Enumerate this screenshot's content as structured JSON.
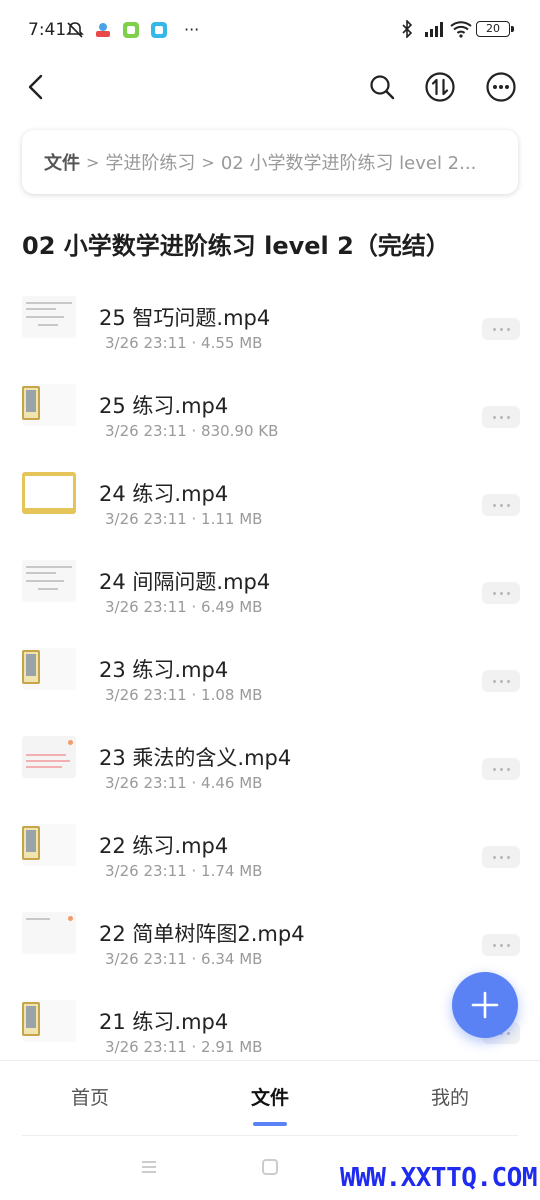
{
  "status_bar": {
    "time": "7:41",
    "more": "···",
    "battery": "20",
    "icons": [
      "mute-icon",
      "app-icon",
      "wechat-icon",
      "app2-icon",
      "bluetooth-icon",
      "signal-icon",
      "wifi-icon",
      "battery-icon"
    ]
  },
  "header": {
    "icons": [
      "back-icon",
      "search-icon",
      "transfer-icon",
      "more-icon"
    ]
  },
  "breadcrumb": {
    "items": [
      "文件",
      "学进阶练习",
      "02 小学数学进阶练习 level 2..."
    ],
    "separator": ">"
  },
  "page_title": "02 小学数学进阶练习 level 2（完结）",
  "files": [
    {
      "name": "25 智巧问题.mp4",
      "date": "3/26 23:11",
      "size": "4.55 MB",
      "thumb": "doc"
    },
    {
      "name": "25 练习.mp4",
      "date": "3/26 23:11",
      "size": "830.90 KB",
      "thumb": "tab"
    },
    {
      "name": "24 练习.mp4",
      "date": "3/26 23:11",
      "size": "1.11 MB",
      "thumb": "yellow"
    },
    {
      "name": "24 间隔问题.mp4",
      "date": "3/26 23:11",
      "size": "6.49 MB",
      "thumb": "doc"
    },
    {
      "name": "23 练习.mp4",
      "date": "3/26 23:11",
      "size": "1.08 MB",
      "thumb": "tab"
    },
    {
      "name": "23 乘法的含义.mp4",
      "date": "3/26 23:11",
      "size": "4.46 MB",
      "thumb": "pink"
    },
    {
      "name": "22 练习.mp4",
      "date": "3/26 23:11",
      "size": "1.74 MB",
      "thumb": "tab"
    },
    {
      "name": "22 简单树阵图2.mp4",
      "date": "3/26 23:11",
      "size": "6.34 MB",
      "thumb": "dot"
    },
    {
      "name": "21 练习.mp4",
      "date": "3/26 23:11",
      "size": "2.91 MB",
      "thumb": "tab"
    }
  ],
  "meta_separator": "·",
  "bottom_nav": {
    "items": [
      "首页",
      "文件",
      "我的"
    ],
    "active": "文件"
  },
  "watermark": "WWW.XXTTQ.COM",
  "colors": {
    "accent": "#5a82f4",
    "watermark": "#1f2cf0"
  }
}
